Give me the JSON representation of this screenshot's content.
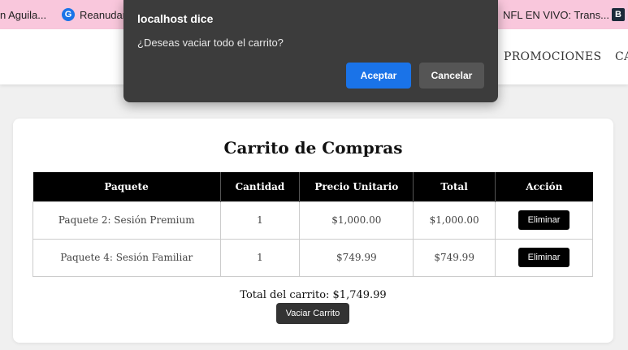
{
  "bookmarks": [
    {
      "label": "n Aguila..."
    },
    {
      "label": "Reanudar",
      "icon": "google-icon"
    },
    {
      "label": "NFL EN VIVO: Trans..."
    },
    {
      "label": "",
      "icon": "bookmark-app-icon"
    }
  ],
  "nav": {
    "promociones": "PROMOCIONES",
    "partial": "CA"
  },
  "cart": {
    "title": "Carrito de Compras",
    "headers": [
      "Paquete",
      "Cantidad",
      "Precio Unitario",
      "Total",
      "Acción"
    ],
    "rows": [
      {
        "paquete": "Paquete 2: Sesión Premium",
        "cantidad": "1",
        "precio": "$1,000.00",
        "total": "$1,000.00",
        "accion": "Eliminar"
      },
      {
        "paquete": "Paquete 4: Sesión Familiar",
        "cantidad": "1",
        "precio": "$749.99",
        "total": "$749.99",
        "accion": "Eliminar"
      }
    ],
    "total_text": "Total del carrito: $1,749.99",
    "empty_label": "Vaciar Carrito"
  },
  "dialog": {
    "title": "localhost dice",
    "message": "¿Deseas vaciar todo el carrito?",
    "ok_label": "Aceptar",
    "cancel_label": "Cancelar"
  },
  "colors": {
    "bookmarks_bar": "#f9c7dc",
    "accent": "#1a73e8",
    "table_header": "#000000"
  }
}
